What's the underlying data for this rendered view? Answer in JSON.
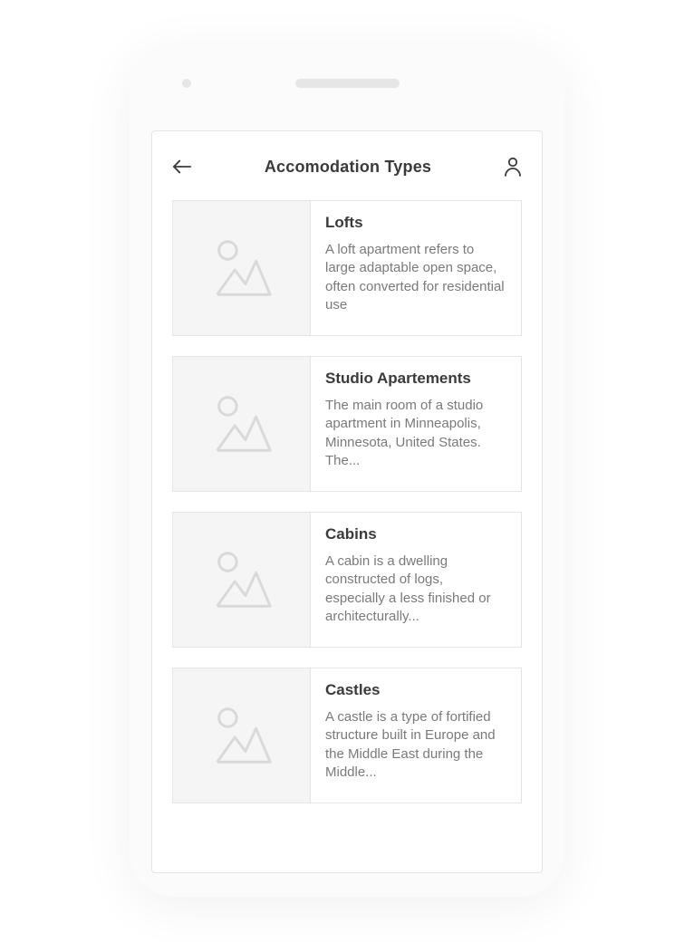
{
  "header": {
    "title": "Accomodation Types"
  },
  "items": [
    {
      "title": "Lofts",
      "description": "A loft apartment refers to large adaptable open space, often converted for residential use"
    },
    {
      "title": "Studio Apartements",
      "description": "The main room of a studio apartment in Minneapolis, Minnesota, United States. The..."
    },
    {
      "title": "Cabins",
      "description": "A cabin is a dwelling constructed of logs, especially a less finished or architecturally..."
    },
    {
      "title": "Castles",
      "description": "A castle is a type of fortified structure built in Europe and the Middle East during the Middle..."
    }
  ]
}
